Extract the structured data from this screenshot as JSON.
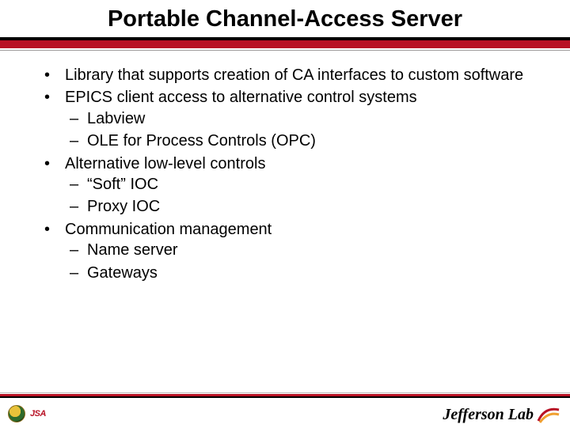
{
  "title": "Portable Channel-Access Server",
  "bullets": {
    "b1": "Library that supports creation of CA interfaces to custom software",
    "b2": "EPICS client access to alternative control systems",
    "b2a": "Labview",
    "b2b": "OLE for Process Controls (OPC)",
    "b3": "Alternative low-level controls",
    "b3a": "“Soft” IOC",
    "b3b": "Proxy IOC",
    "b4": "Communication management",
    "b4a": "Name server",
    "b4b": "Gateways"
  },
  "footer": {
    "left_abbrev": "JSA",
    "right_label": "Jefferson Lab"
  }
}
